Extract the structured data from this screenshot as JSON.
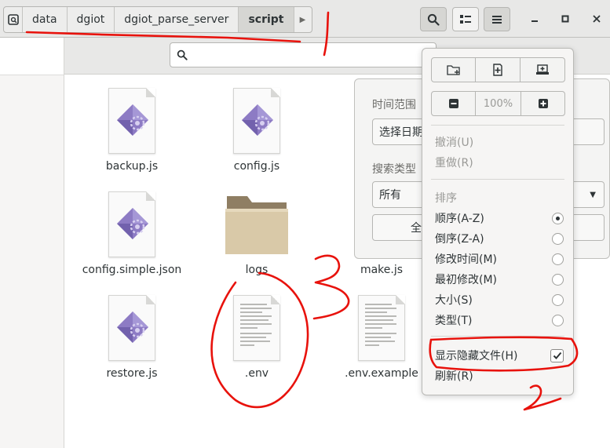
{
  "path_bar": {
    "segments": [
      "data",
      "dgiot",
      "dgiot_parse_server",
      "script"
    ],
    "active": "script"
  },
  "search": {
    "placeholder": ""
  },
  "files": [
    {
      "name": "backup.js",
      "icon": "js-file-icon"
    },
    {
      "name": "config.js",
      "icon": "js-file-icon"
    },
    {
      "name": "config.simple.json",
      "icon": "js-file-icon"
    },
    {
      "name": "logs",
      "icon": "folder-icon"
    },
    {
      "name": "make.js",
      "icon": "js-file-icon"
    },
    {
      "name": "restore.js",
      "icon": "js-file-icon"
    },
    {
      "name": ".env",
      "icon": "text-file-icon"
    },
    {
      "name": ".env.example",
      "icon": "text-file-icon"
    }
  ],
  "search_popover": {
    "time_range_label": "时间范围",
    "time_range_button": "选择日期",
    "search_type_label": "搜索类型",
    "search_type_value": "所有",
    "bottom_button": "全"
  },
  "menu": {
    "zoom": "100%",
    "undo": "撤消(U)",
    "redo": "重做(R)",
    "sort_header": "排序",
    "sort_options": [
      {
        "label": "顺序(A-Z)",
        "selected": true
      },
      {
        "label": "倒序(Z-A)",
        "selected": false
      },
      {
        "label": "修改时间(M)",
        "selected": false
      },
      {
        "label": "最初修改(M)",
        "selected": false
      },
      {
        "label": "大小(S)",
        "selected": false
      },
      {
        "label": "类型(T)",
        "selected": false
      }
    ],
    "show_hidden": "显示隐藏文件(H)",
    "show_hidden_checked": true,
    "refresh": "刷新(R)"
  },
  "annotations": {
    "number_3": "3",
    "number_2": "2"
  },
  "colors": {
    "annotation_ink": "#e8120c",
    "js_icon": "#8d7bc4",
    "folder": "#d9c9a8"
  }
}
